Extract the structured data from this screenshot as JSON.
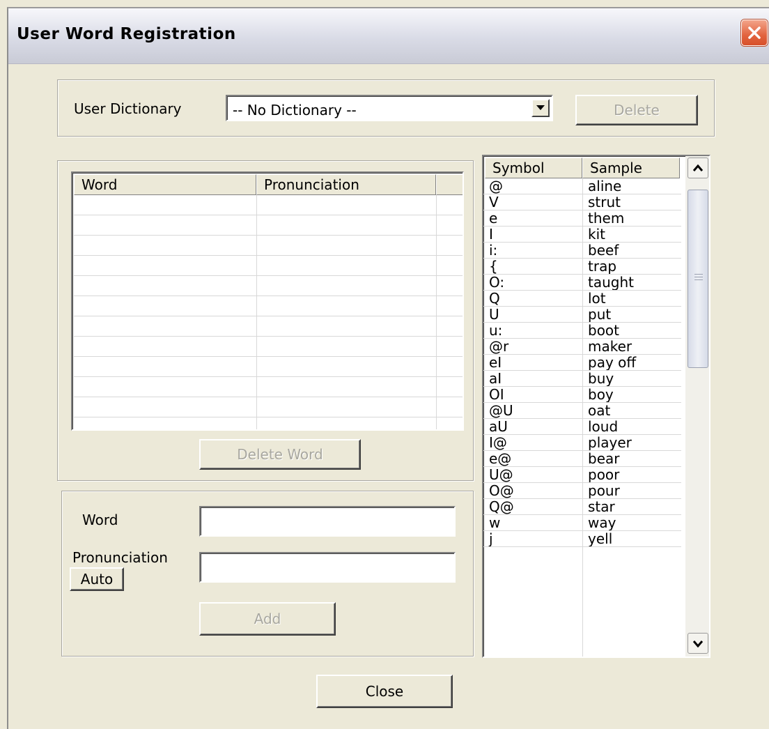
{
  "window": {
    "title": "User Word Registration"
  },
  "dictionary": {
    "label": "User Dictionary",
    "selected": "-- No Dictionary --",
    "delete_label": "Delete"
  },
  "word_list": {
    "columns": [
      "Word",
      "Pronunciation"
    ],
    "delete_word_label": "Delete Word"
  },
  "entry": {
    "word_label": "Word",
    "word_value": "",
    "pronunciation_label": "Pronunciation",
    "pronunciation_value": "",
    "auto_label": "Auto",
    "add_label": "Add"
  },
  "symbols": {
    "columns": [
      "Symbol",
      "Sample"
    ],
    "rows": [
      [
        "@",
        "aline"
      ],
      [
        "V",
        "strut"
      ],
      [
        "e",
        "them"
      ],
      [
        "I",
        "kit"
      ],
      [
        "i:",
        "beef"
      ],
      [
        "{",
        "trap"
      ],
      [
        "O:",
        "taught"
      ],
      [
        "Q",
        "lot"
      ],
      [
        "U",
        "put"
      ],
      [
        "u:",
        "boot"
      ],
      [
        "@r",
        "maker"
      ],
      [
        "eI",
        "pay off"
      ],
      [
        "aI",
        "buy"
      ],
      [
        "OI",
        "boy"
      ],
      [
        "@U",
        "oat"
      ],
      [
        "aU",
        "loud"
      ],
      [
        "I@",
        "player"
      ],
      [
        "e@",
        "bear"
      ],
      [
        "U@",
        "poor"
      ],
      [
        "O@",
        "pour"
      ],
      [
        "Q@",
        "star"
      ],
      [
        "w",
        "way"
      ],
      [
        "j",
        "yell"
      ]
    ]
  },
  "footer": {
    "close_label": "Close"
  }
}
